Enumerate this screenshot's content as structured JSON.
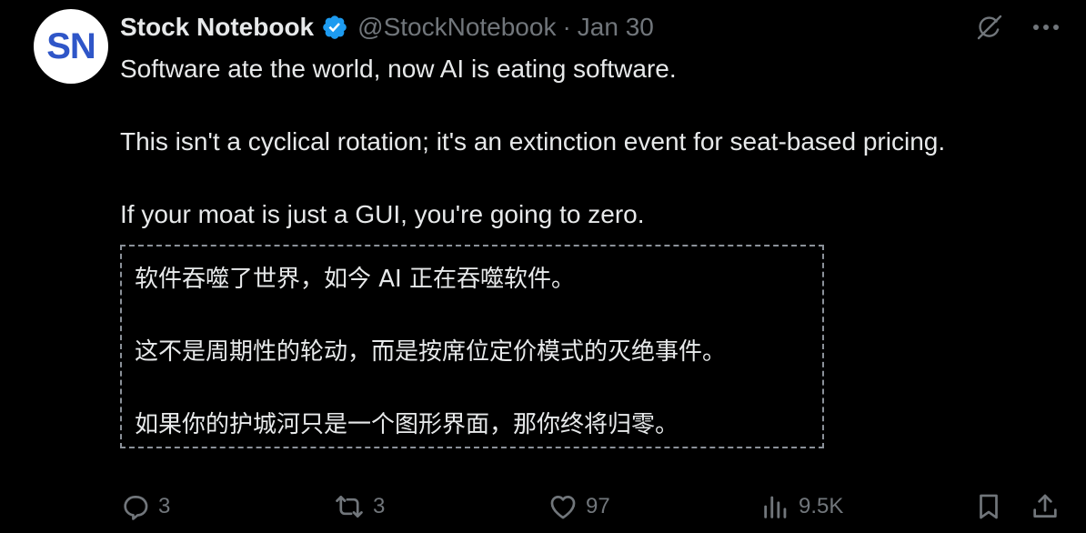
{
  "author": {
    "avatar_initials": "SN",
    "name": "Stock Notebook",
    "handle": "@StockNotebook",
    "separator": "·",
    "date": "Jan 30"
  },
  "tweet": {
    "paragraphs": [
      "Software ate the world, now AI is eating software.",
      "This isn't a cyclical rotation; it's an extinction event for seat-based pricing.",
      "If your moat is just a GUI, you're going to zero."
    ]
  },
  "translation": {
    "paragraphs": [
      "软件吞噬了世界，如今 AI 正在吞噬软件。",
      "这不是周期性的轮动，而是按席位定价模式的灭绝事件。",
      "如果你的护城河只是一个图形界面，那你终将归零。"
    ]
  },
  "actions": {
    "replies": "3",
    "reposts": "3",
    "likes": "97",
    "views": "9.5K"
  },
  "icons": {
    "verified": "verified-badge-icon",
    "grok": "grok-icon",
    "more": "more-icon",
    "reply": "reply-icon",
    "repost": "repost-icon",
    "like": "heart-icon",
    "views": "views-icon",
    "bookmark": "bookmark-icon",
    "share": "share-icon"
  },
  "colors": {
    "background": "#000000",
    "text_primary": "#e7e9ea",
    "text_secondary": "#71767b",
    "verified_blue": "#1d9bf0",
    "avatar_text": "#2f56c8"
  }
}
